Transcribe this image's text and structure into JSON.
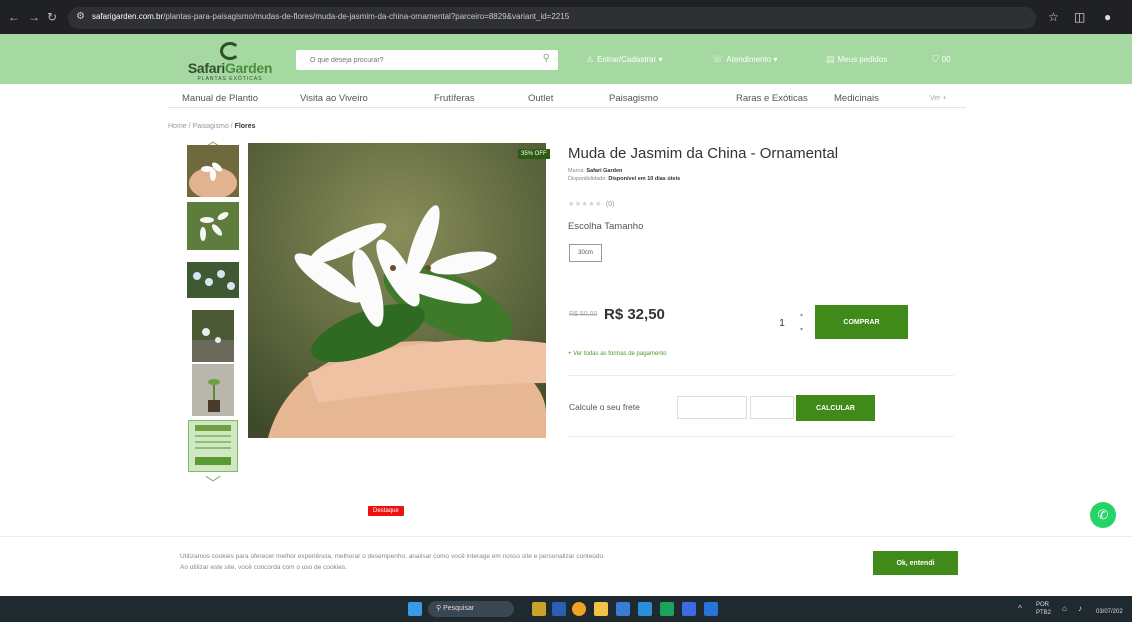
{
  "browser": {
    "url_domain": "safarigarden.com.br",
    "url_path": "/plantas-para-paisagismo/mudas-de-flores/muda-de-jasmim-da-china-ornamental?parceiro=8829&variant_id=2215"
  },
  "header": {
    "logo_main": "Safari",
    "logo_accent": "Garden",
    "logo_tagline": "PLANTAS EXÓTICAS",
    "search_placeholder": "O que deseja procurar?",
    "login_label": "Entrar/Cadastrar",
    "support_label": "Atendimento",
    "orders_label": "Meus pedidos",
    "cart_count": "00"
  },
  "menu": [
    "Manual de Plantio",
    "Visita ao Viveiro",
    "Frutíferas",
    "Outlet",
    "Paisagismo",
    "Raras e Exóticas",
    "Medicinais",
    "Ver +"
  ],
  "breadcrumb": {
    "home": "Home",
    "section": "Paisagismo",
    "current": "Flores"
  },
  "product": {
    "discount_badge": "35% OFF",
    "title": "Muda de Jasmim da China - Ornamental",
    "brand_label": "Marca:",
    "brand": "Safari Garden",
    "availability_label": "Disponibilidade:",
    "availability": "Disponível em 10 dias úteis",
    "rating_count": "(0)",
    "size_label": "Escolha Tamanho",
    "size_option": "30cm",
    "old_price": "R$ 50,00",
    "price": "R$ 32,50",
    "quantity": "1",
    "buy_label": "COMPRAR",
    "payments_link": "+ Ver todas as formas de pagamento",
    "shipping_label": "Calcule o seu frete",
    "calculate_label": "CALCULAR",
    "highlight_badge": "Destaque"
  },
  "cookie": {
    "text_line1": "Utilizamos cookies para oferecer melhor experiência, melhorar o desempenho, analisar como você interage em nosso site e personalizar conteúdo.",
    "text_line2": "Ao utilizar este site, você concorda com o uso de cookies.",
    "accept_label": "Ok, entendi"
  },
  "taskbar": {
    "search_label": "Pesquisar",
    "lang": "POR",
    "layout": "PTB2",
    "date": "03/07/202"
  }
}
